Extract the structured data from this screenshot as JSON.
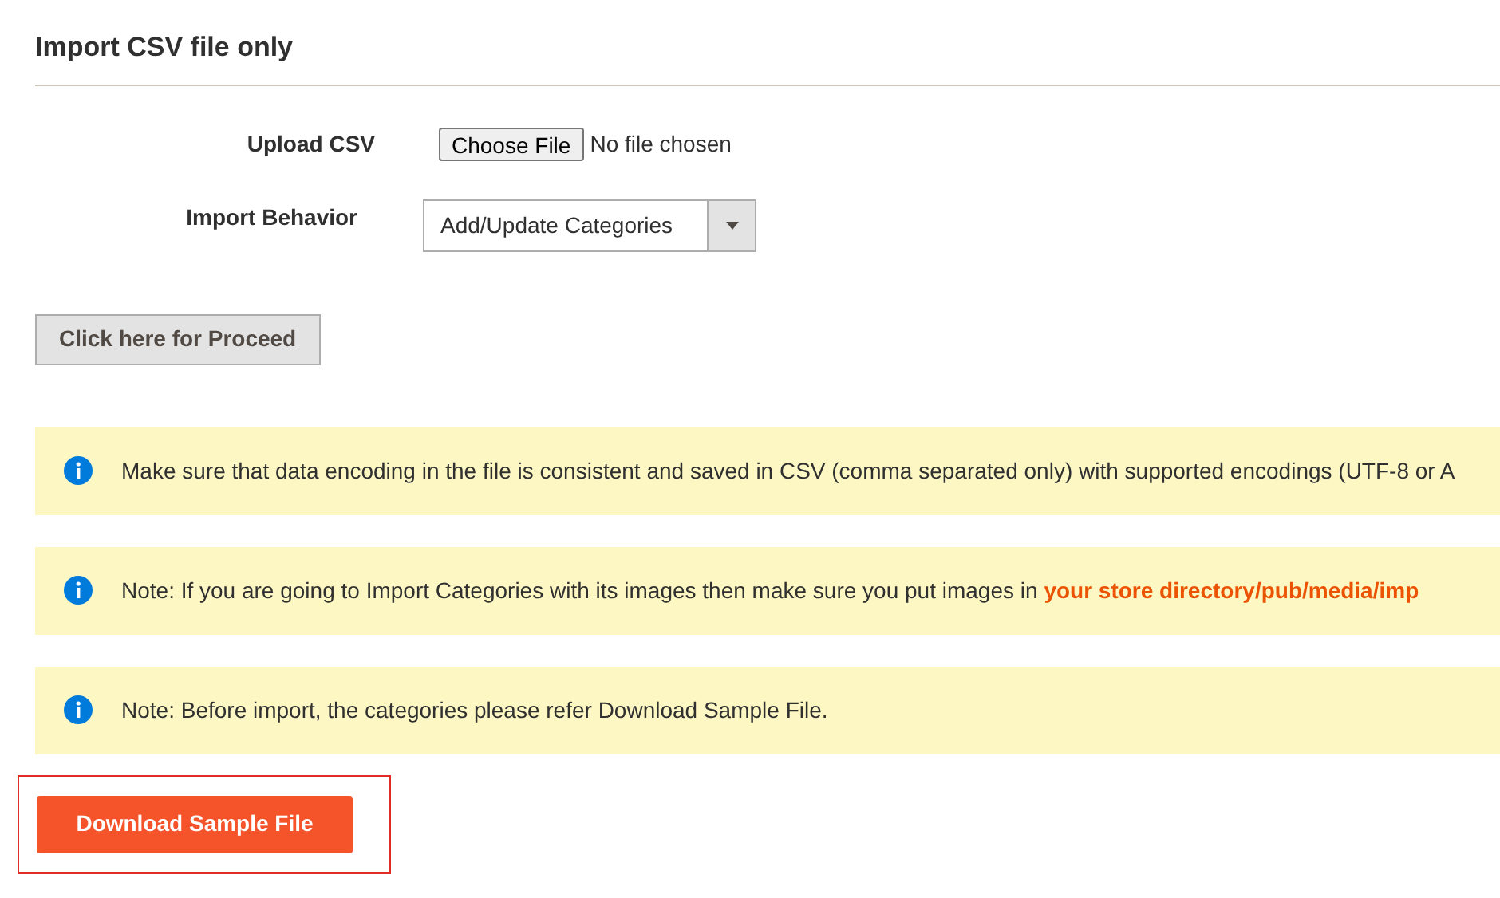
{
  "section_title": "Import CSV file only",
  "upload": {
    "label": "Upload CSV",
    "button": "Choose File",
    "status": "No file chosen"
  },
  "behavior": {
    "label": "Import Behavior",
    "value": "Add/Update Categories"
  },
  "proceed_button": "Click here for Proceed",
  "notes": [
    {
      "text": "Make sure that data encoding in the file is consistent and saved in CSV (comma separated only) with supported encodings (UTF-8 or A"
    },
    {
      "text": "Note: If you are going to Import Categories with its images then make sure you put images in **your store directory/pub/media/imp**"
    },
    {
      "text": "Note: Before import, the categories please refer Download Sample File."
    }
  ],
  "download_button": {
    "label": "Download Sample File",
    "highlighted": true
  }
}
